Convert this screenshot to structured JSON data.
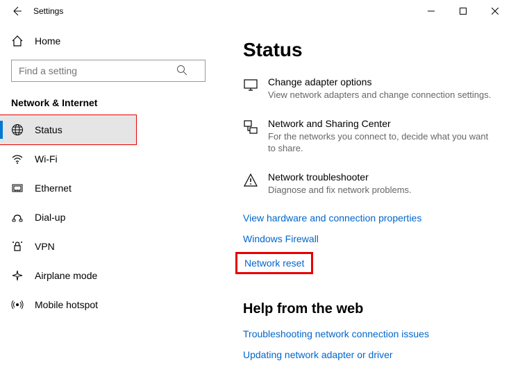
{
  "window": {
    "title": "Settings"
  },
  "sidebar": {
    "home": "Home",
    "search_placeholder": "Find a setting",
    "category": "Network & Internet",
    "items": [
      {
        "label": "Status",
        "selected": true
      },
      {
        "label": "Wi-Fi"
      },
      {
        "label": "Ethernet"
      },
      {
        "label": "Dial-up"
      },
      {
        "label": "VPN"
      },
      {
        "label": "Airplane mode"
      },
      {
        "label": "Mobile hotspot"
      }
    ]
  },
  "content": {
    "title": "Status",
    "options": [
      {
        "title": "Change adapter options",
        "desc": "View network adapters and change connection settings."
      },
      {
        "title": "Network and Sharing Center",
        "desc": "For the networks you connect to, decide what you want to share."
      },
      {
        "title": "Network troubleshooter",
        "desc": "Diagnose and fix network problems."
      }
    ],
    "links": [
      "View hardware and connection properties",
      "Windows Firewall",
      "Network reset"
    ],
    "help": {
      "title": "Help from the web",
      "links": [
        "Troubleshooting network connection issues",
        "Updating network adapter or driver"
      ]
    }
  }
}
